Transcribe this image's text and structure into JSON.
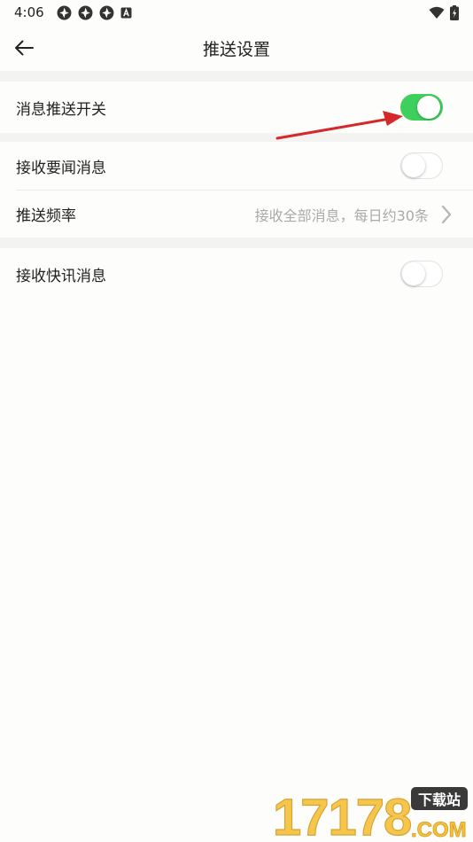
{
  "status_bar": {
    "time": "4:06",
    "icons": [
      "aperture-icon",
      "aperture-icon",
      "aperture-icon",
      "a-badge-icon"
    ],
    "right_icons": [
      "wifi-icon",
      "battery-charging-icon"
    ]
  },
  "app_bar": {
    "title": "推送设置",
    "back_icon": "arrow-left-icon"
  },
  "settings": {
    "push_switch": {
      "label": "消息推送开关",
      "on": true
    },
    "headline": {
      "label": "接收要闻消息",
      "on": false
    },
    "frequency": {
      "label": "推送频率",
      "value": "接收全部消息，每日约30条"
    },
    "flash": {
      "label": "接收快讯消息",
      "on": false
    }
  },
  "colors": {
    "toggle_on": "#3fcf5c",
    "annotation_arrow": "#d62828",
    "page_background": "#fdfdfb",
    "section_gap": "#f3f3f1"
  },
  "watermark": {
    "number": "17178",
    "badge": "下载站",
    "suffix": ".COM"
  }
}
